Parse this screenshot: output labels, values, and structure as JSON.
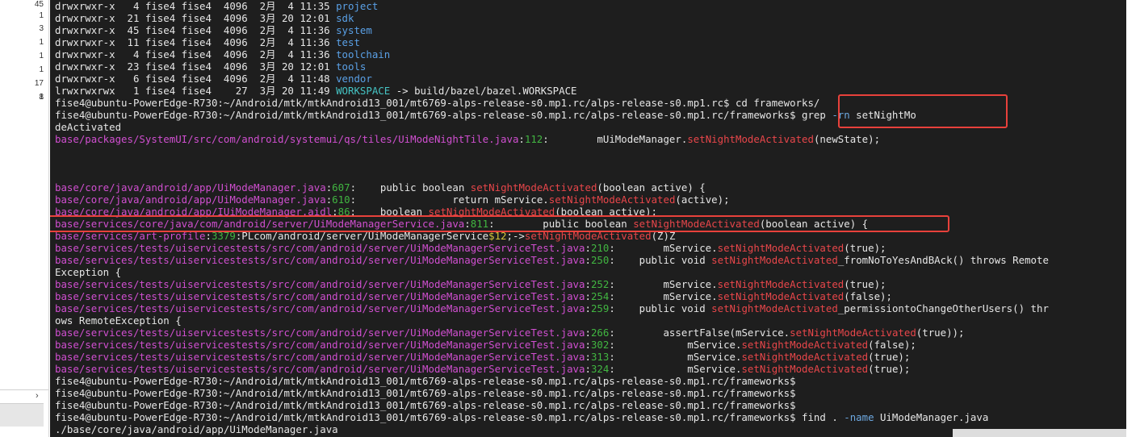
{
  "sidebar": {
    "numbers": [
      "45",
      "1",
      "3",
      "1",
      "1",
      "1",
      "17",
      "1",
      "8"
    ],
    "chevron": "›"
  },
  "terminal": {
    "lines": [
      [
        {
          "t": "drwxrwxr-x   4 fise4 fise4  4096  2月  4 11:35 ",
          "c": "plain"
        },
        {
          "t": "project",
          "c": "dir"
        }
      ],
      [
        {
          "t": "drwxrwxr-x  21 fise4 fise4  4096  3月 20 12:01 ",
          "c": "plain"
        },
        {
          "t": "sdk",
          "c": "dir"
        }
      ],
      [
        {
          "t": "drwxrwxr-x  45 fise4 fise4  4096  2月  4 11:36 ",
          "c": "plain"
        },
        {
          "t": "system",
          "c": "dir"
        }
      ],
      [
        {
          "t": "drwxrwxr-x  11 fise4 fise4  4096  2月  4 11:36 ",
          "c": "plain"
        },
        {
          "t": "test",
          "c": "dir"
        }
      ],
      [
        {
          "t": "drwxrwxr-x   4 fise4 fise4  4096  2月  4 11:36 ",
          "c": "plain"
        },
        {
          "t": "toolchain",
          "c": "dir"
        }
      ],
      [
        {
          "t": "drwxrwxr-x  23 fise4 fise4  4096  3月 20 12:01 ",
          "c": "plain"
        },
        {
          "t": "tools",
          "c": "dir"
        }
      ],
      [
        {
          "t": "drwxrwxr-x   6 fise4 fise4  4096  2月  4 11:48 ",
          "c": "plain"
        },
        {
          "t": "vendor",
          "c": "dir"
        }
      ],
      [
        {
          "t": "lrwxrwxrwx   1 fise4 fise4    27  3月 20 11:49 ",
          "c": "plain"
        },
        {
          "t": "WORKSPACE",
          "c": "link"
        },
        {
          "t": " -> build/bazel/bazel.WORKSPACE",
          "c": "plain"
        }
      ],
      [
        {
          "t": "fise4@ubuntu-PowerEdge-R730:~/Android/mtk/mtkAndroid13_001/mt6769-alps-release-s0.mp1.rc/alps-release-s0.mp1.rc$ cd frameworks/",
          "c": "plain"
        }
      ],
      [
        {
          "t": "fise4@ubuntu-PowerEdge-R730:~/Android/mtk/mtkAndroid13_001/mt6769-alps-release-s0.mp1.rc/alps-release-s0.mp1.rc/frameworks$ grep ",
          "c": "plain"
        },
        {
          "t": "-rn",
          "c": "opt"
        },
        {
          "t": " setNightMo",
          "c": "plain"
        }
      ],
      [
        {
          "t": "deActivated",
          "c": "plain"
        }
      ],
      [
        {
          "t": "base/packages/SystemUI/src/com/android/systemui/qs/tiles/UiModeNightTile.java",
          "c": "path"
        },
        {
          "t": ":",
          "c": "plain"
        },
        {
          "t": "112",
          "c": "num"
        },
        {
          "t": ":        mUiModeManager.",
          "c": "plain"
        },
        {
          "t": "setNightModeActivated",
          "c": "match"
        },
        {
          "t": "(newState);",
          "c": "plain"
        }
      ],
      [
        {
          "t": "",
          "c": "plain"
        }
      ],
      [
        {
          "t": "",
          "c": "plain"
        }
      ],
      [
        {
          "t": "",
          "c": "plain"
        }
      ],
      [
        {
          "t": "base/core/java/android/app/UiModeManager.java",
          "c": "path"
        },
        {
          "t": ":",
          "c": "plain"
        },
        {
          "t": "607",
          "c": "num"
        },
        {
          "t": ":    public boolean ",
          "c": "plain"
        },
        {
          "t": "setNightModeActivated",
          "c": "match"
        },
        {
          "t": "(boolean active) {",
          "c": "plain"
        }
      ],
      [
        {
          "t": "base/core/java/android/app/UiModeManager.java",
          "c": "path"
        },
        {
          "t": ":",
          "c": "plain"
        },
        {
          "t": "610",
          "c": "num"
        },
        {
          "t": ":                return mService.",
          "c": "plain"
        },
        {
          "t": "setNightModeActivated",
          "c": "match"
        },
        {
          "t": "(active);",
          "c": "plain"
        }
      ],
      [
        {
          "t": "base/core/java/android/app/IUiModeManager.aidl",
          "c": "path"
        },
        {
          "t": ":",
          "c": "plain"
        },
        {
          "t": "86",
          "c": "num"
        },
        {
          "t": ":    boolean ",
          "c": "plain"
        },
        {
          "t": "setNightModeActivated",
          "c": "match"
        },
        {
          "t": "(boolean active);",
          "c": "plain"
        }
      ],
      [
        {
          "t": "base/services/core/java/com/android/server/UiModeManagerService.java",
          "c": "path"
        },
        {
          "t": ":",
          "c": "plain"
        },
        {
          "t": "811",
          "c": "num"
        },
        {
          "t": ":        public boolean ",
          "c": "plain"
        },
        {
          "t": "setNightModeActivated",
          "c": "match"
        },
        {
          "t": "(boolean active) {",
          "c": "plain"
        }
      ],
      [
        {
          "t": "base/services/art-profile",
          "c": "path"
        },
        {
          "t": ":",
          "c": "plain"
        },
        {
          "t": "3379",
          "c": "num"
        },
        {
          "t": ":PLcom/android/server/UiModeManagerService",
          "c": "plain"
        },
        {
          "t": "$12",
          "c": "yel"
        },
        {
          "t": ";->",
          "c": "plain"
        },
        {
          "t": "setNightModeActivated",
          "c": "match"
        },
        {
          "t": "(Z)Z",
          "c": "plain"
        }
      ],
      [
        {
          "t": "base/services/tests/uiservicestests/src/com/android/server/UiModeManagerServiceTest.java",
          "c": "path"
        },
        {
          "t": ":",
          "c": "plain"
        },
        {
          "t": "210",
          "c": "num"
        },
        {
          "t": ":        mService.",
          "c": "plain"
        },
        {
          "t": "setNightModeActivated",
          "c": "match"
        },
        {
          "t": "(true);",
          "c": "plain"
        }
      ],
      [
        {
          "t": "base/services/tests/uiservicestests/src/com/android/server/UiModeManagerServiceTest.java",
          "c": "path"
        },
        {
          "t": ":",
          "c": "plain"
        },
        {
          "t": "250",
          "c": "num"
        },
        {
          "t": ":    public void ",
          "c": "plain"
        },
        {
          "t": "setNightModeActivated",
          "c": "match"
        },
        {
          "t": "_fromNoToYesAndBAck() throws Remote",
          "c": "plain"
        }
      ],
      [
        {
          "t": "Exception {",
          "c": "plain"
        }
      ],
      [
        {
          "t": "base/services/tests/uiservicestests/src/com/android/server/UiModeManagerServiceTest.java",
          "c": "path"
        },
        {
          "t": ":",
          "c": "plain"
        },
        {
          "t": "252",
          "c": "num"
        },
        {
          "t": ":        mService.",
          "c": "plain"
        },
        {
          "t": "setNightModeActivated",
          "c": "match"
        },
        {
          "t": "(true);",
          "c": "plain"
        }
      ],
      [
        {
          "t": "base/services/tests/uiservicestests/src/com/android/server/UiModeManagerServiceTest.java",
          "c": "path"
        },
        {
          "t": ":",
          "c": "plain"
        },
        {
          "t": "254",
          "c": "num"
        },
        {
          "t": ":        mService.",
          "c": "plain"
        },
        {
          "t": "setNightModeActivated",
          "c": "match"
        },
        {
          "t": "(false);",
          "c": "plain"
        }
      ],
      [
        {
          "t": "base/services/tests/uiservicestests/src/com/android/server/UiModeManagerServiceTest.java",
          "c": "path"
        },
        {
          "t": ":",
          "c": "plain"
        },
        {
          "t": "259",
          "c": "num"
        },
        {
          "t": ":    public void ",
          "c": "plain"
        },
        {
          "t": "setNightModeActivated",
          "c": "match"
        },
        {
          "t": "_permissiontoChangeOtherUsers() thr",
          "c": "plain"
        }
      ],
      [
        {
          "t": "ows RemoteException {",
          "c": "plain"
        }
      ],
      [
        {
          "t": "base/services/tests/uiservicestests/src/com/android/server/UiModeManagerServiceTest.java",
          "c": "path"
        },
        {
          "t": ":",
          "c": "plain"
        },
        {
          "t": "266",
          "c": "num"
        },
        {
          "t": ":        assertFalse(mService.",
          "c": "plain"
        },
        {
          "t": "setNightModeActivated",
          "c": "match"
        },
        {
          "t": "(true));",
          "c": "plain"
        }
      ],
      [
        {
          "t": "base/services/tests/uiservicestests/src/com/android/server/UiModeManagerServiceTest.java",
          "c": "path"
        },
        {
          "t": ":",
          "c": "plain"
        },
        {
          "t": "302",
          "c": "num"
        },
        {
          "t": ":            mService.",
          "c": "plain"
        },
        {
          "t": "setNightModeActivated",
          "c": "match"
        },
        {
          "t": "(false);",
          "c": "plain"
        }
      ],
      [
        {
          "t": "base/services/tests/uiservicestests/src/com/android/server/UiModeManagerServiceTest.java",
          "c": "path"
        },
        {
          "t": ":",
          "c": "plain"
        },
        {
          "t": "313",
          "c": "num"
        },
        {
          "t": ":            mService.",
          "c": "plain"
        },
        {
          "t": "setNightModeActivated",
          "c": "match"
        },
        {
          "t": "(true);",
          "c": "plain"
        }
      ],
      [
        {
          "t": "base/services/tests/uiservicestests/src/com/android/server/UiModeManagerServiceTest.java",
          "c": "path"
        },
        {
          "t": ":",
          "c": "plain"
        },
        {
          "t": "324",
          "c": "num"
        },
        {
          "t": ":            mService.",
          "c": "plain"
        },
        {
          "t": "setNightModeActivated",
          "c": "match"
        },
        {
          "t": "(true);",
          "c": "plain"
        }
      ],
      [
        {
          "t": "fise4@ubuntu-PowerEdge-R730:~/Android/mtk/mtkAndroid13_001/mt6769-alps-release-s0.mp1.rc/alps-release-s0.mp1.rc/frameworks$",
          "c": "plain"
        }
      ],
      [
        {
          "t": "fise4@ubuntu-PowerEdge-R730:~/Android/mtk/mtkAndroid13_001/mt6769-alps-release-s0.mp1.rc/alps-release-s0.mp1.rc/frameworks$",
          "c": "plain"
        }
      ],
      [
        {
          "t": "fise4@ubuntu-PowerEdge-R730:~/Android/mtk/mtkAndroid13_001/mt6769-alps-release-s0.mp1.rc/alps-release-s0.mp1.rc/frameworks$",
          "c": "plain"
        }
      ],
      [
        {
          "t": "fise4@ubuntu-PowerEdge-R730:~/Android/mtk/mtkAndroid13_001/mt6769-alps-release-s0.mp1.rc/alps-release-s0.mp1.rc/frameworks$ find . ",
          "c": "plain"
        },
        {
          "t": "-name",
          "c": "opt"
        },
        {
          "t": " UiModeManager.java",
          "c": "plain"
        }
      ],
      [
        {
          "t": "./base/core/java/android/app/UiModeManager.java",
          "c": "plain"
        }
      ]
    ]
  },
  "colors": {
    "terminal_bg": "#1e1e1e",
    "path": "#d04fd0",
    "line_number": "#41b641",
    "match": "#e8464a",
    "directory": "#5aa0e6",
    "annotation_box": "#e8413b"
  }
}
